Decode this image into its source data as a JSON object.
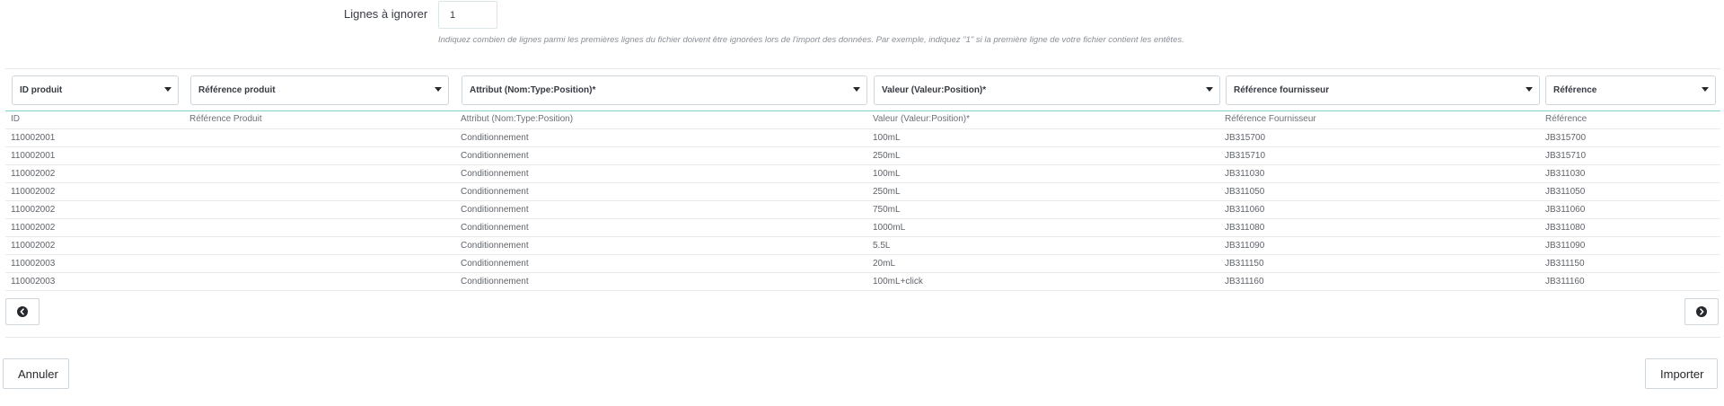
{
  "skip": {
    "label": "Lignes à ignorer",
    "value": "1",
    "help": "Indiquez combien de lignes parmi les premières lignes du fichier doivent être ignorées lors de l'import des données. Par exemple, indiquez \"1\" si la première ligne de votre fichier contient les entêtes."
  },
  "mapping": {
    "selects": [
      "ID produit",
      "Référence produit",
      "Attribut (Nom:Type:Position)*",
      "Valeur (Valeur:Position)*",
      "Référence fournisseur",
      "Référence"
    ],
    "headers": [
      "ID",
      "Référence Produit",
      "Attribut (Nom:Type:Position)",
      "Valeur (Valeur:Position)*",
      "Référence Fournisseur",
      "Référence"
    ],
    "rows": [
      [
        "110002001",
        "",
        "Conditionnement",
        "100mL",
        "JB315700",
        "JB315700"
      ],
      [
        "110002001",
        "",
        "Conditionnement",
        "250mL",
        "JB315710",
        "JB315710"
      ],
      [
        "110002002",
        "",
        "Conditionnement",
        "100mL",
        "JB311030",
        "JB311030"
      ],
      [
        "110002002",
        "",
        "Conditionnement",
        "250mL",
        "JB311050",
        "JB311050"
      ],
      [
        "110002002",
        "",
        "Conditionnement",
        "750mL",
        "JB311060",
        "JB311060"
      ],
      [
        "110002002",
        "",
        "Conditionnement",
        "1000mL",
        "JB311080",
        "JB311080"
      ],
      [
        "110002002",
        "",
        "Conditionnement",
        "5.5L",
        "JB311090",
        "JB311090"
      ],
      [
        "110002003",
        "",
        "Conditionnement",
        "20mL",
        "JB311150",
        "JB311150"
      ],
      [
        "110002003",
        "",
        "Conditionnement",
        "100mL+click",
        "JB311160",
        "JB311160"
      ]
    ],
    "prev_icon": "chevron-circle-left-icon",
    "next_icon": "chevron-circle-right-icon"
  },
  "actions": {
    "cancel_label": "Annuler",
    "import_label": "Importer"
  }
}
